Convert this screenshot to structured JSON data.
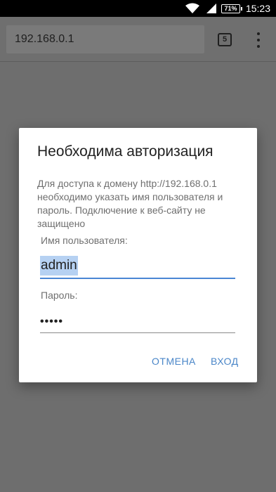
{
  "status_bar": {
    "battery_percent": "71%",
    "time": "15:23",
    "icons": [
      "wifi-icon",
      "signal-icon",
      "battery-icon"
    ]
  },
  "browser": {
    "url": "192.168.0.1",
    "tab_count": "5",
    "menu_icon": "more-vertical-icon"
  },
  "dialog": {
    "title": "Необходима авторизация",
    "message": "Для доступа к домену http://192.168.0.1 необходимо указать имя пользователя и пароль. Подключение к веб-сайту не защищено",
    "username_label": "Имя пользователя:",
    "username_value": "admin",
    "password_label": "Пароль:",
    "password_value": "•••••",
    "cancel_label": "ОТМЕНА",
    "login_label": "ВХОД"
  },
  "colors": {
    "accent": "#4a86c8",
    "scrim": "#6e6e6e"
  }
}
